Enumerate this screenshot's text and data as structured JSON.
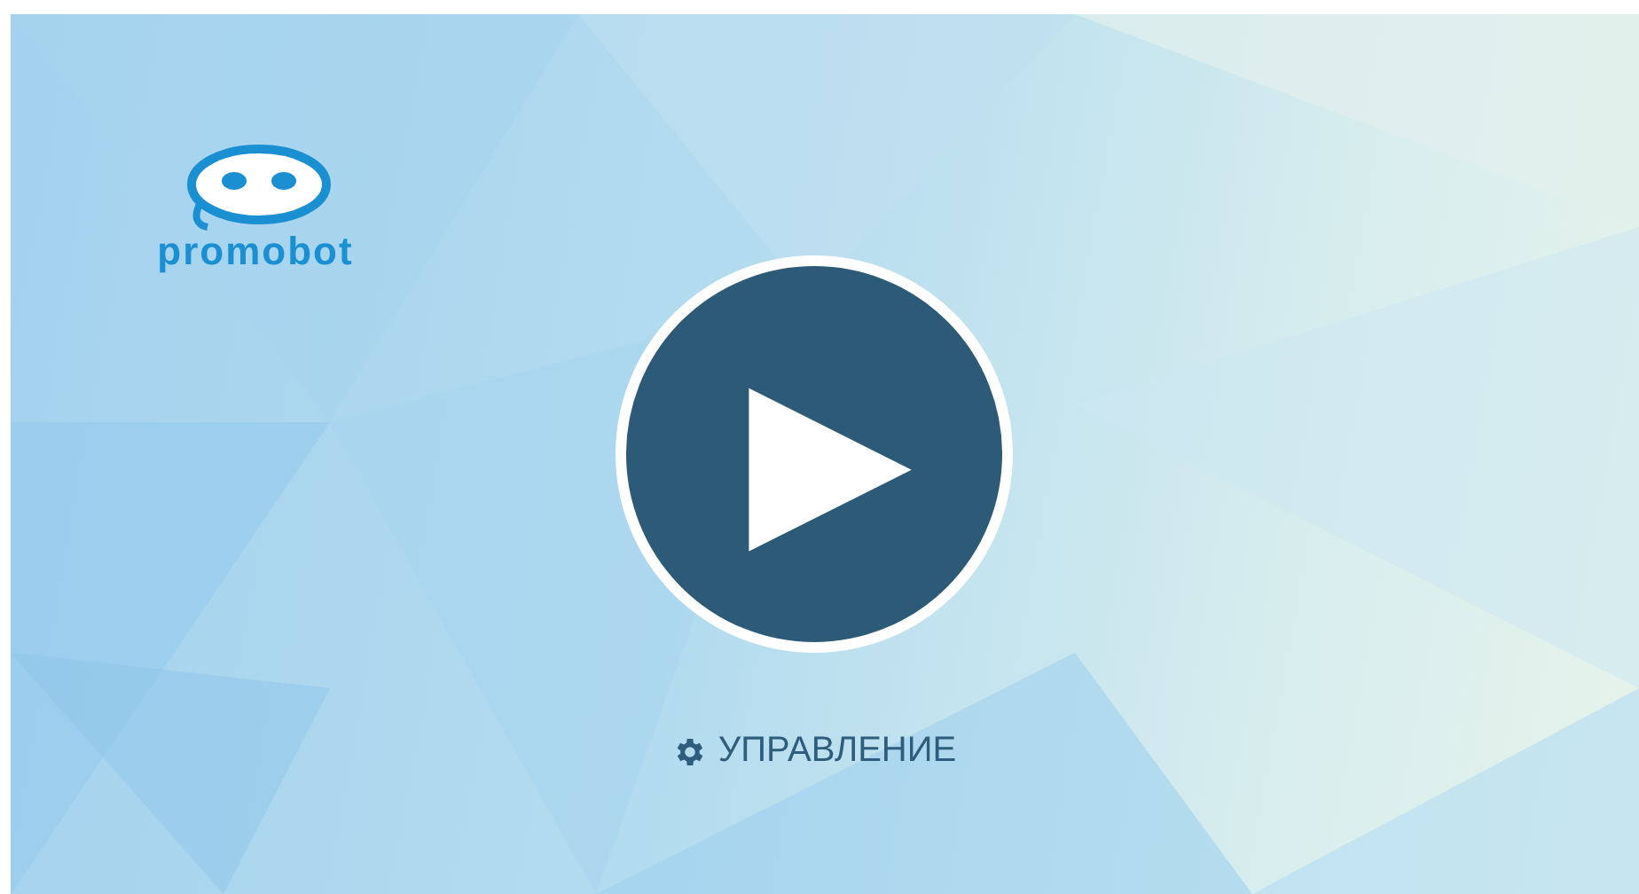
{
  "logo": {
    "text": "promobot"
  },
  "play_button": {
    "label": "▶"
  },
  "control_link": {
    "label": "УПРАВЛЕНИЕ"
  }
}
